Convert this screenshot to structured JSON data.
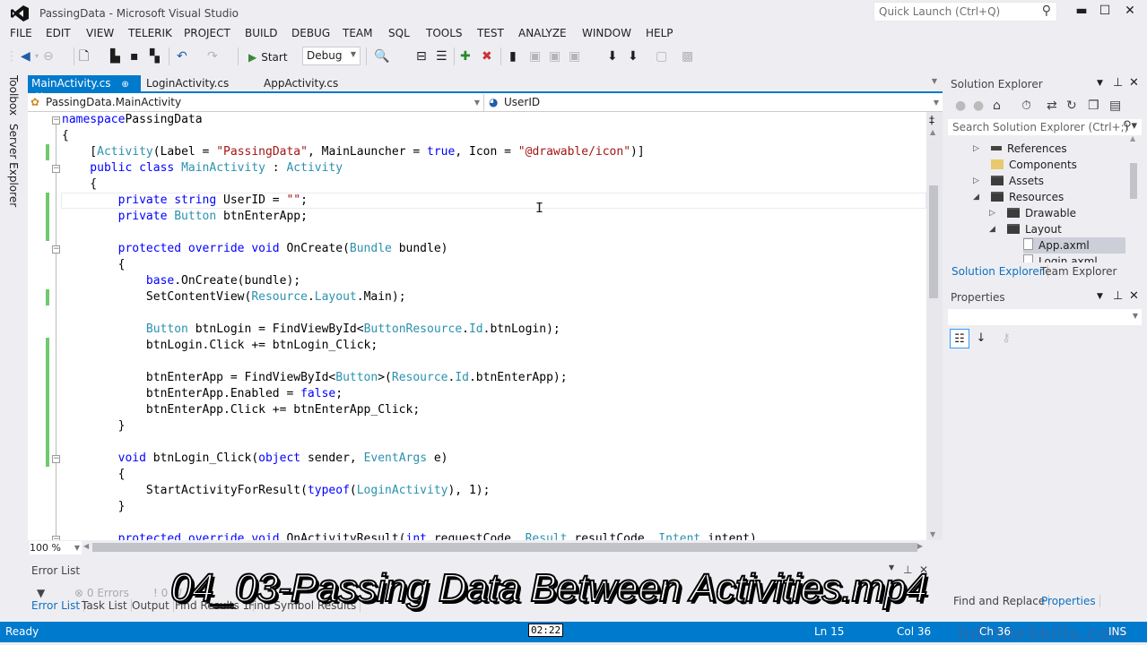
{
  "window": {
    "title": "PassingData - Microsoft Visual Studio",
    "quick_launch_placeholder": "Quick Launch (Ctrl+Q)",
    "minimize": "▬",
    "maximize": "☐",
    "close": "✕"
  },
  "menu": [
    "FILE",
    "EDIT",
    "VIEW",
    "TELERIK",
    "PROJECT",
    "BUILD",
    "DEBUG",
    "TEAM",
    "SQL",
    "TOOLS",
    "TEST",
    "ANALYZE",
    "WINDOW",
    "HELP"
  ],
  "toolbar": {
    "start_label": "Start",
    "configuration": "Debug"
  },
  "left_sidebar": {
    "toolbox": "Toolbox",
    "server_explorer": "Server Explorer"
  },
  "doc_tabs": [
    {
      "label": "MainActivity.cs",
      "active": true
    },
    {
      "label": "LoginActivity.cs",
      "active": false
    },
    {
      "label": "AppActivity.cs",
      "active": false
    }
  ],
  "navbar": {
    "type_dropdown": "PassingData.MainActivity",
    "member_dropdown": "UserID"
  },
  "editor": {
    "zoom": "100 %",
    "lines": [
      [
        [
          "kw",
          "namespace"
        ],
        [
          "",
          "PassingData"
        ]
      ],
      [
        [
          "",
          "{"
        ]
      ],
      [
        [
          "",
          "    ["
        ],
        [
          "ty",
          "Activity"
        ],
        [
          "",
          "(Label = "
        ],
        [
          "st",
          "\"PassingData\""
        ],
        [
          "",
          ", MainLauncher = "
        ],
        [
          "kw",
          "true"
        ],
        [
          "",
          ", Icon = "
        ],
        [
          "st",
          "\"@drawable/icon\""
        ],
        [
          "",
          ")]"
        ]
      ],
      [
        [
          "kw",
          "    public class "
        ],
        [
          "ty",
          "MainActivity"
        ],
        [
          "",
          " : "
        ],
        [
          "ty",
          "Activity"
        ]
      ],
      [
        [
          "",
          "    {"
        ]
      ],
      [
        [
          "kw",
          "        private string "
        ],
        [
          "",
          "UserID = "
        ],
        [
          "st",
          "\"\""
        ],
        [
          "",
          ";"
        ]
      ],
      [
        [
          "kw",
          "        private "
        ],
        [
          "ty",
          "Button"
        ],
        [
          "",
          " btnEnterApp;"
        ]
      ],
      [
        [
          "",
          ""
        ]
      ],
      [
        [
          "kw",
          "        protected override void "
        ],
        [
          "",
          "OnCreate("
        ],
        [
          "ty",
          "Bundle"
        ],
        [
          "",
          " bundle)"
        ]
      ],
      [
        [
          "",
          "        {"
        ]
      ],
      [
        [
          "kw",
          "            base"
        ],
        [
          "",
          ".OnCreate(bundle);"
        ]
      ],
      [
        [
          "",
          "            SetContentView("
        ],
        [
          "ty",
          "Resource"
        ],
        [
          "",
          "."
        ],
        [
          "ty",
          "Layout"
        ],
        [
          "",
          ".Main);"
        ]
      ],
      [
        [
          "",
          ""
        ]
      ],
      [
        [
          "ty",
          "            Button"
        ],
        [
          "",
          " btnLogin = FindViewById<"
        ],
        [
          "ty",
          "Button"
        ],
        [
          ">("
        ],
        [
          "ty",
          "Resource"
        ],
        [
          "",
          "."
        ],
        [
          "ty",
          "Id"
        ],
        [
          "",
          ".btnLogin);"
        ]
      ],
      [
        [
          "",
          "            btnLogin.Click += btnLogin_Click;"
        ]
      ],
      [
        [
          "",
          ""
        ]
      ],
      [
        [
          "",
          "            btnEnterApp = FindViewById<"
        ],
        [
          "ty",
          "Button"
        ],
        [
          "",
          ">("
        ],
        [
          "ty",
          "Resource"
        ],
        [
          "",
          "."
        ],
        [
          "ty",
          "Id"
        ],
        [
          "",
          ".btnEnterApp);"
        ]
      ],
      [
        [
          "",
          "            btnEnterApp.Enabled = "
        ],
        [
          "kw",
          "false"
        ],
        [
          "",
          ";"
        ]
      ],
      [
        [
          "",
          "            btnEnterApp.Click += btnEnterApp_Click;"
        ]
      ],
      [
        [
          "",
          "        }"
        ]
      ],
      [
        [
          "",
          ""
        ]
      ],
      [
        [
          "kw",
          "        void "
        ],
        [
          "",
          "btnLogin_Click("
        ],
        [
          "kw",
          "object"
        ],
        [
          "",
          " sender, "
        ],
        [
          "ty",
          "EventArgs"
        ],
        [
          "",
          " e)"
        ]
      ],
      [
        [
          "",
          "        {"
        ]
      ],
      [
        [
          "",
          "            StartActivityForResult("
        ],
        [
          "kw",
          "typeof"
        ],
        [
          "",
          "("
        ],
        [
          "ty",
          "LoginActivity"
        ],
        [
          "",
          "), 1);"
        ]
      ],
      [
        [
          "",
          "        }"
        ]
      ],
      [
        [
          "",
          ""
        ]
      ],
      [
        [
          "kw",
          "        protected override void "
        ],
        [
          "",
          "OnActivityResult("
        ],
        [
          "kw",
          "int"
        ],
        [
          "",
          " requestCode, "
        ],
        [
          "ty",
          "Result"
        ],
        [
          "",
          " resultCode, "
        ],
        [
          "ty",
          "Intent"
        ],
        [
          "",
          " intent)"
        ]
      ]
    ]
  },
  "error_list": {
    "title": "Error List",
    "errors": "0 Errors",
    "warnings": "0 W",
    "tabs": [
      "Error List",
      "Task List",
      "Output",
      "Find Results 1",
      "Find Symbol Results"
    ]
  },
  "solution_explorer": {
    "title": "Solution Explorer",
    "search_placeholder": "Search Solution Explorer (Ctrl+;)",
    "tree": [
      {
        "label": "References",
        "icon": "references",
        "expander": "▷",
        "level": 0
      },
      {
        "label": "Components",
        "icon": "folder-yellow",
        "expander": "",
        "level": 0
      },
      {
        "label": "Assets",
        "icon": "folder",
        "expander": "▷",
        "level": 0
      },
      {
        "label": "Resources",
        "icon": "folder",
        "expander": "◢",
        "level": 0
      },
      {
        "label": "Drawable",
        "icon": "folder",
        "expander": "▷",
        "level": 1
      },
      {
        "label": "Layout",
        "icon": "folder",
        "expander": "◢",
        "level": 1
      },
      {
        "label": "App.axml",
        "icon": "file",
        "expander": "",
        "level": 2,
        "selected": true
      },
      {
        "label": "Login.axml",
        "icon": "file",
        "expander": "",
        "level": 2
      }
    ],
    "tabs": [
      "Solution Explorer",
      "Team Explorer"
    ]
  },
  "properties": {
    "title": "Properties",
    "tabs": [
      "Find and Replace",
      "Properties"
    ]
  },
  "status": {
    "ready": "Ready",
    "timecode": "02:22",
    "line": "Ln 15",
    "col": "Col 36",
    "ch": "Ch 36",
    "mode": "INS",
    "watermark": "InfiniteSkills.com"
  },
  "overlay": {
    "caption": "04_03-Passing Data Between Activities.mp4"
  },
  "colors": {
    "accent": "#007acc",
    "keyword": "#0000ff",
    "type": "#2b91af",
    "string": "#a31515",
    "change_marker": "#6fc96f"
  }
}
